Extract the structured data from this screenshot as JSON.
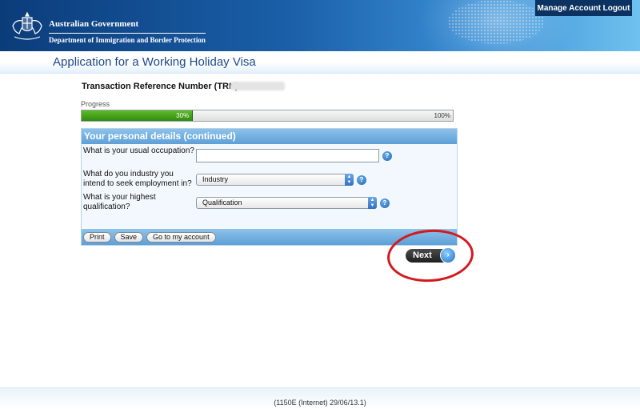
{
  "header": {
    "gov_line1": "Australian Government",
    "gov_line2": "Department of Immigration and Border Protection",
    "manage_account": "Manage Account",
    "logout": "Logout",
    "crest_icon": "coat-of-arms-icon"
  },
  "page": {
    "title": "Application for a Working Holiday Visa"
  },
  "trn": {
    "label": "Transaction Reference Number (TRN):"
  },
  "progress": {
    "label": "Progress",
    "value_percent": 30,
    "current_text": "30%",
    "max_text": "100%"
  },
  "panel": {
    "heading": "Your personal details (continued)",
    "occupation": {
      "label": "What is your usual occupation?",
      "value": ""
    },
    "industry": {
      "label": "What do you industry you intend to seek employment in?",
      "selected": "Industry"
    },
    "qualification": {
      "label": "What is your highest qualification?",
      "selected": "Qualification"
    },
    "help_glyph": "?",
    "footer_buttons": {
      "print": "Print",
      "save": "Save",
      "account": "Go to my account"
    }
  },
  "next": {
    "label": "Next",
    "arrow_glyph": "›"
  },
  "footer": {
    "text": "(1150E (Internet) 29/06/13.1)"
  },
  "colors": {
    "header_dark": "#0b3c7a",
    "title_blue": "#1e4a8c",
    "progress_green": "#2f8b0d",
    "panel_blue": "#5e9fd6",
    "annotation_red": "#d4191d"
  }
}
